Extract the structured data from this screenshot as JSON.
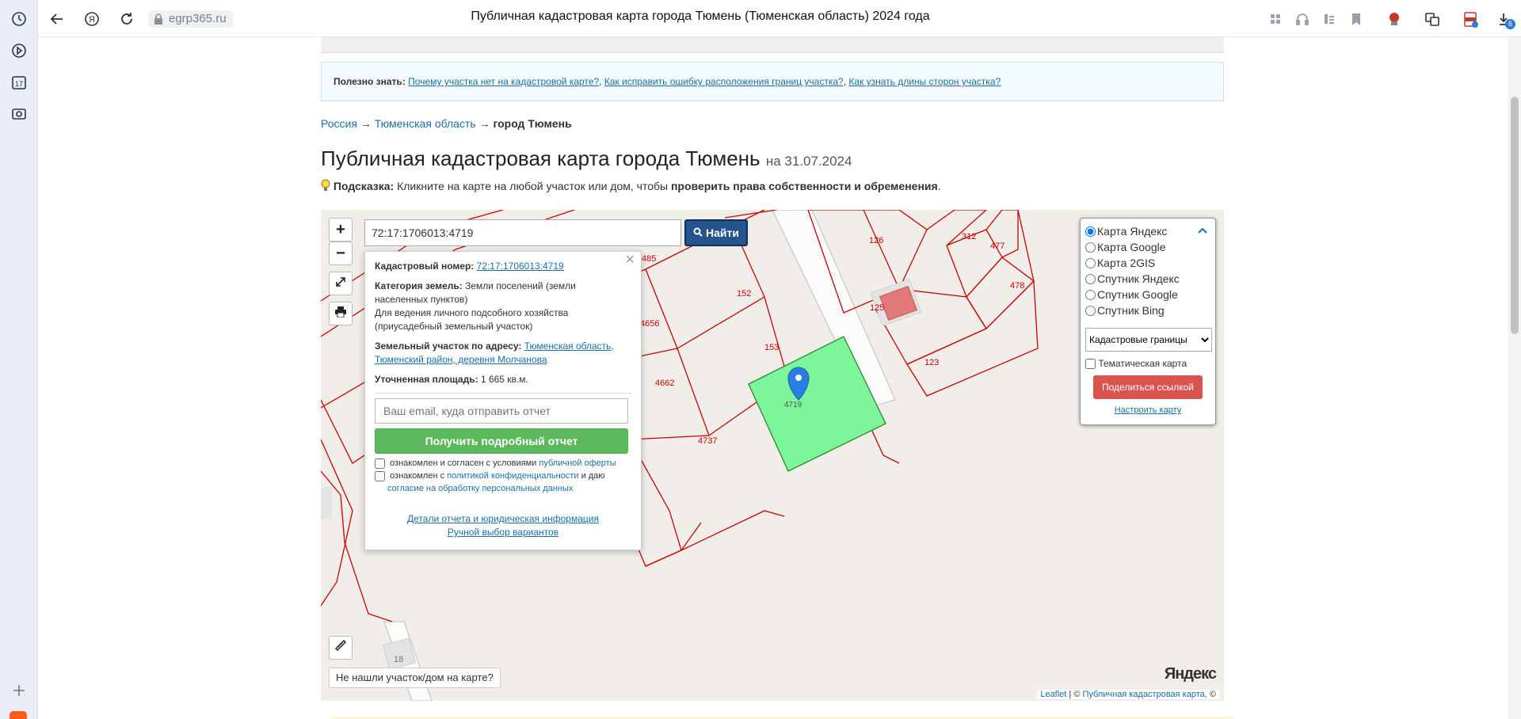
{
  "browser": {
    "url": "egrp365.ru",
    "title": "Публичная кадастровая карта города Тюмень (Тюменская область) 2024 года",
    "download_badge": "6",
    "calendar_day": "17"
  },
  "infobox": {
    "label": "Полезно знать:",
    "links": [
      "Почему участка нет на кадастровой карте?",
      "Как исправить ошибку расположения границ участка?",
      "Как узнать длины сторон участка?"
    ]
  },
  "breadcrumb": {
    "items": [
      "Россия",
      "Тюменская область"
    ],
    "separator": "→",
    "current": "город Тюмень"
  },
  "heading": {
    "title": "Публичная кадастровая карта города Тюмень",
    "date": "на 31.07.2024"
  },
  "hint": {
    "label": "Подсказка:",
    "text": "Кликните на карте на любой участок или дом, чтобы",
    "bold": "проверить права собственности и обременения",
    "end": "."
  },
  "map": {
    "zoom_in": "+",
    "zoom_out": "−",
    "search_value": "72:17:1706013:4719",
    "search_button": "Найти",
    "popup": {
      "cadnum_label": "Кадастровый номер:",
      "cadnum": "72:17:1706013:4719",
      "category_label": "Категория земель:",
      "category": "Земли поселений (земли населенных пунктов)",
      "usage": "Для ведения личного подсобного хозяйства (приусадебный земельный участок)",
      "address_label": "Земельный участок по адресу:",
      "address": "Тюменская область, Тюменский район, деревня Молчанова",
      "area_label": "Уточненная площадь:",
      "area": "1 665 кв.м.",
      "email_placeholder": "Ваш email, куда отправить отчет",
      "report_button": "Получить подробный отчет",
      "check1_text": "ознакомлен и согласен с условиями",
      "check1_link": "публичной оферты",
      "check2_text": "ознакомлен с",
      "check2_link": "политикой конфиденциальности",
      "check2_mid": "и даю",
      "check2_link2": "согласие на обработку персональных данных",
      "details_link": "Детали отчета и юридическая информация",
      "manual_link": "Ручной выбор вариантов"
    },
    "layers": {
      "options": [
        "Карта Яндекс",
        "Карта Google",
        "Карта 2GIS",
        "Спутник Яндекс",
        "Спутник Google",
        "Спутник Bing"
      ],
      "selected": "Карта Яндекс",
      "overlay_select": "Кадастровые границы",
      "thematic": "Тематическая карта",
      "share_button": "Поделиться ссылкой",
      "setup_link": "Настроить карту"
    },
    "parcels": [
      "126",
      "312",
      "477",
      "478",
      "485",
      "152",
      "125",
      "4656",
      "153",
      "123",
      "4662",
      "4719",
      "4737",
      "18"
    ],
    "not_found": "Не нашли участок/дом на карте?",
    "attribution": {
      "leaflet": "Leaflet",
      "sep": "|",
      "copy": "©",
      "source": "Публичная кадастровая карта,",
      "tail": "©"
    },
    "yandex_logo": "Яндекс"
  },
  "colors": {
    "parcel_line": "#cc0000",
    "selected_parcel": "#7df59a",
    "search_button": "#23548b",
    "report_button": "#5cb85c",
    "share_button": "#d9534f"
  }
}
